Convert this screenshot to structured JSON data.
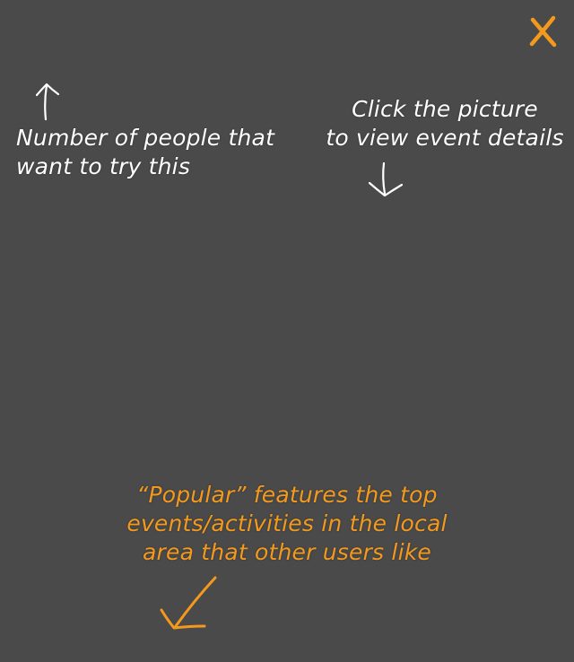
{
  "overlay": {
    "background_color": "#4a4a4a",
    "accent_color": "#f39a1e",
    "close_icon": "close-icon"
  },
  "hints": {
    "left": {
      "lines": [
        "Number of people that",
        "want to try this"
      ],
      "arrow_direction": "up"
    },
    "right": {
      "lines": [
        "Click the picture",
        "to view event details"
      ],
      "arrow_direction": "down"
    },
    "bottom": {
      "lines": [
        "“Popular” features the top",
        "events/activities in the local",
        "area that other users like"
      ],
      "arrow_direction": "down-left"
    }
  }
}
